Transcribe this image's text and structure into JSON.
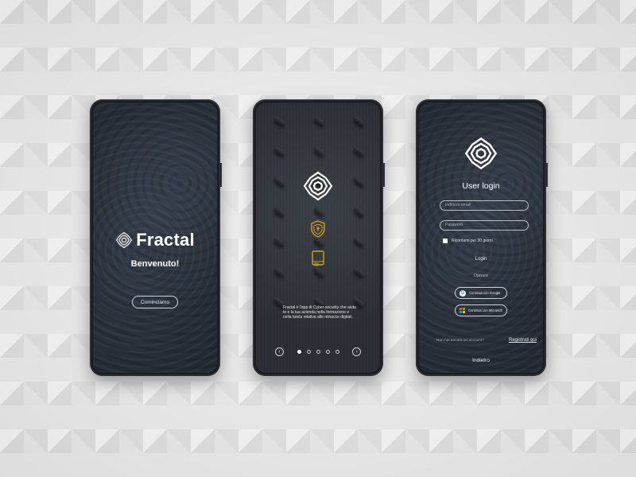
{
  "colors": {
    "screen_bg": "#232a33",
    "accent_gold": "#d4a017",
    "text_white": "#ffffff"
  },
  "welcome_screen": {
    "brand": "Fractal",
    "welcome_text": "Benvenuto!",
    "start_button": "Cominciamo",
    "logo_icon": "fractal-logo-icon"
  },
  "intro_screen": {
    "logo_icon": "fractal-logo-icon",
    "icons": [
      "shield-lock-icon",
      "book-icon"
    ],
    "description": "Fractal è l'app di Cyber-security che aiuta te e la tua azienda nella formazione e nella tutela relativa alle minacce digitali.",
    "prev_icon": "chevron-left-icon",
    "next_icon": "chevron-right-icon",
    "pages_total": 5,
    "active_page": 1
  },
  "login_screen": {
    "logo_icon": "fractal-logo-icon",
    "title": "User login",
    "email_placeholder": "Indirizzo email",
    "password_placeholder": "Password",
    "remember_label": "Ricordami per 30 giorni",
    "login_button": "Login",
    "or_text": "Oppure",
    "google_button": "Continua con Google",
    "microsoft_button": "Continua con Microsoft",
    "no_account_text": "Non hai ancora un account?",
    "register_link": "Registrati qui",
    "back_button": "Indietro"
  }
}
